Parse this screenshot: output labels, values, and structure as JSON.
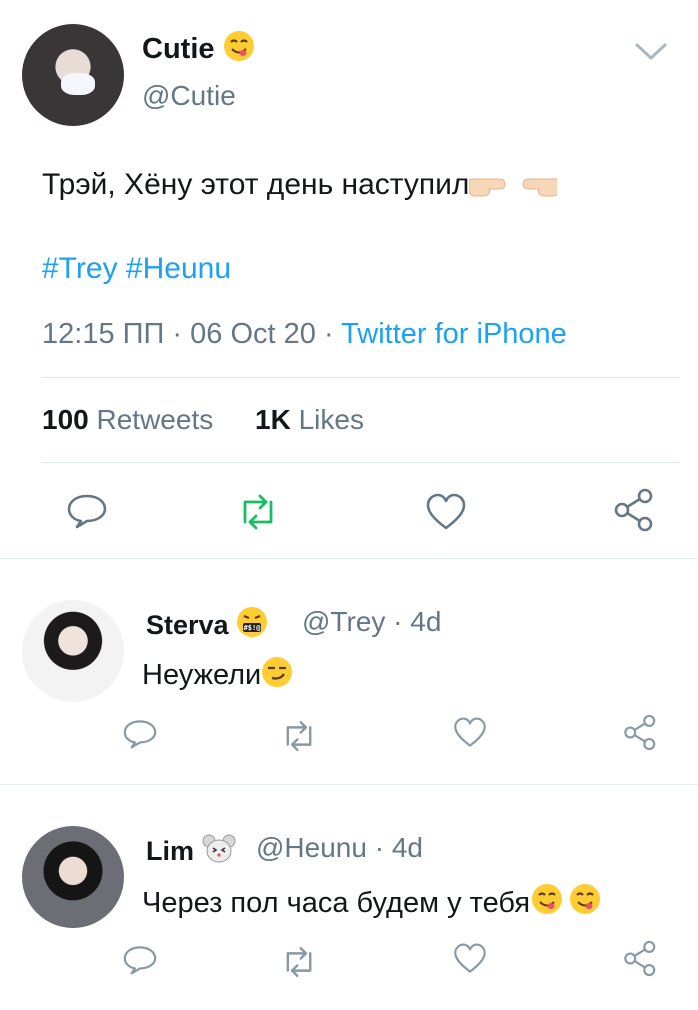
{
  "main_tweet": {
    "author_name": "Cutie",
    "author_handle": "@Cutie",
    "text": "Трэй, Хёну этот день наступил",
    "hashtags": [
      "#Trey",
      "#Heunu"
    ],
    "time": "12:15 ПП",
    "date": "06 Oct 20",
    "source": "Twitter for iPhone",
    "retweets_count": "100",
    "retweets_label": "Retweets",
    "likes_count": "1K",
    "likes_label": "Likes",
    "accent_color": "#1da1f2",
    "retweet_active_color": "#17bf63"
  },
  "replies": [
    {
      "author_name": "Sterva",
      "author_handle": "@Trey",
      "time_ago": "4d",
      "text": "Неужели"
    },
    {
      "author_name": "Lim",
      "author_handle": "@Heunu",
      "time_ago": "4d",
      "text": "Через пол часа будем у тебя"
    }
  ],
  "icons": {
    "reply": "reply-icon",
    "retweet": "retweet-icon",
    "like": "heart-icon",
    "share": "share-icon",
    "menu": "chevron-down-icon"
  },
  "separator": "·"
}
